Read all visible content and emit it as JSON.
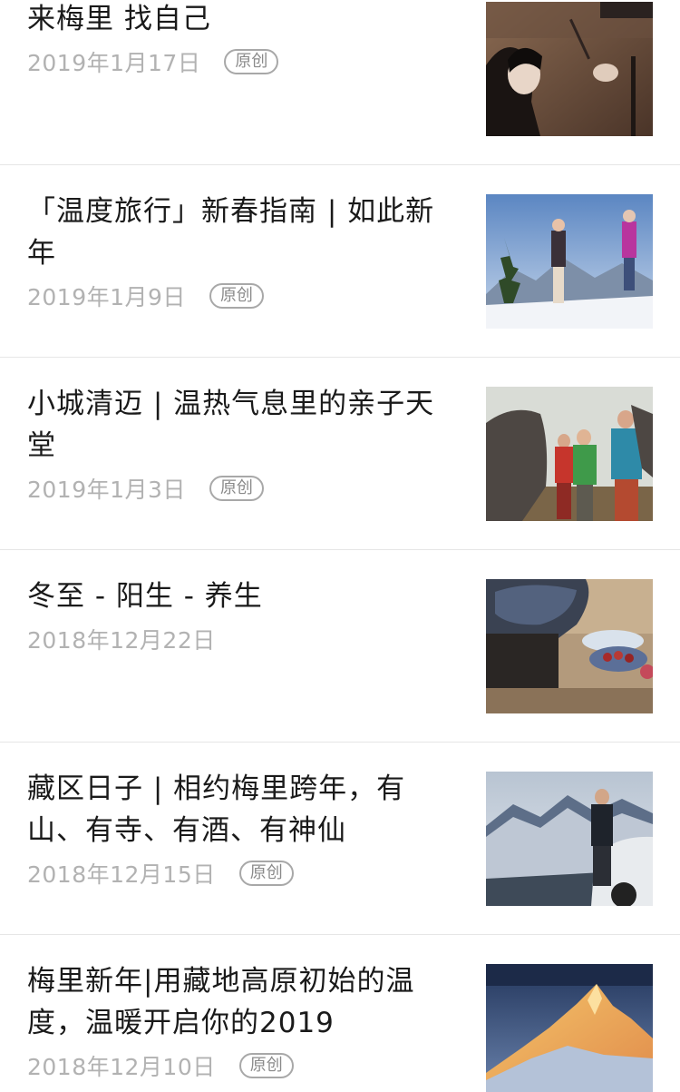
{
  "articles": [
    {
      "title": "来梅里 找自己",
      "date": "2019年1月17日",
      "tag": "原创",
      "thumb_icon": "woman-sunlight-photo"
    },
    {
      "title": "「温度旅行」新春指南 | 如此新年",
      "date": "2019年1月9日",
      "tag": "原创",
      "thumb_icon": "snow-mountain-jumping-photo"
    },
    {
      "title": "小城清迈 | 温热气息里的亲子天堂",
      "date": "2019年1月3日",
      "tag": "原创",
      "thumb_icon": "elephant-family-photo"
    },
    {
      "title": "冬至 - 阳生 - 养生",
      "date": "2018年12月22日",
      "tag": "",
      "thumb_icon": "picnic-basket-photo"
    },
    {
      "title": "藏区日子 | 相约梅里跨年，有山、有寺、有酒、有神仙",
      "date": "2018年12月15日",
      "tag": "原创",
      "thumb_icon": "man-car-mountain-photo"
    },
    {
      "title": "梅里新年|用藏地高原初始的温度，温暖开启你的2019",
      "date": "2018年12月10日",
      "tag": "原创",
      "thumb_icon": "golden-peak-photo"
    }
  ],
  "colors": {
    "title": "#1a1a1a",
    "date": "#b2b2b2",
    "tag_border": "#a8a8a8",
    "divider": "#e6e6e6"
  }
}
